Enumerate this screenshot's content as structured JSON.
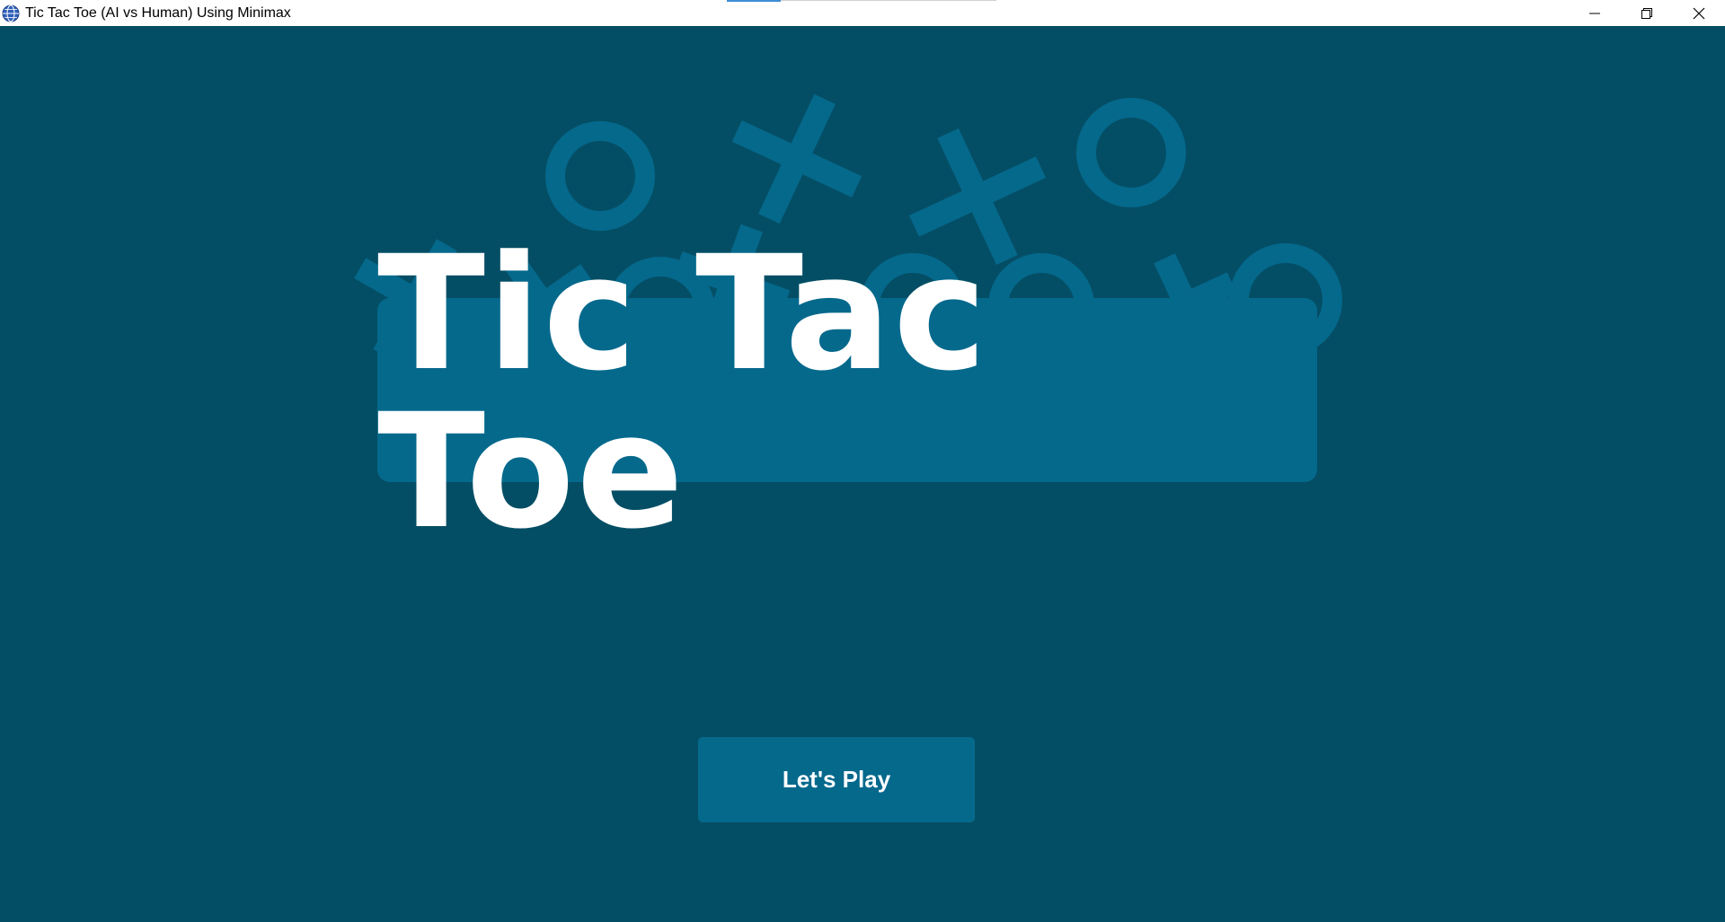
{
  "window": {
    "title": "Tic Tac Toe (AI vs Human) Using Minimax",
    "app_icon": "globe-icon",
    "controls": [
      "minimize-icon",
      "restore-icon",
      "close-icon"
    ]
  },
  "logo": {
    "title": "Tic Tac Toe",
    "decorations": [
      "o-mark-icon",
      "x-mark-icon"
    ]
  },
  "actions": {
    "play_label": "Let's Play"
  },
  "colors": {
    "background": "#044e65",
    "panel": "#05698c",
    "text": "#ffffff"
  }
}
